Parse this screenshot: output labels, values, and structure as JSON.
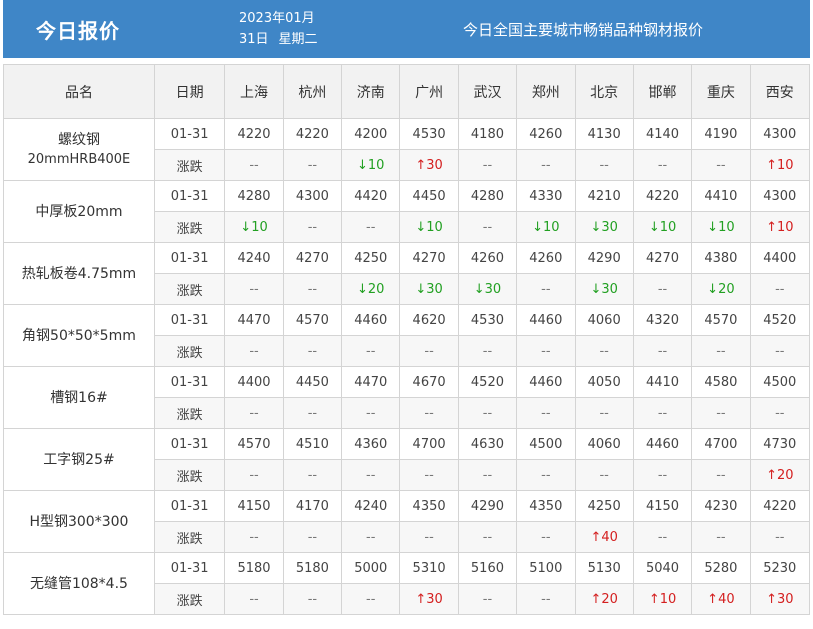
{
  "header": {
    "title": "今日报价",
    "date_line1": "2023年01月",
    "date_day": "31日",
    "date_weekday": "星期二",
    "description": "今日全国主要城市畅销品种钢材报价"
  },
  "table": {
    "col_name": "品名",
    "col_date": "日期",
    "cities": [
      "上海",
      "杭州",
      "济南",
      "广州",
      "武汉",
      "郑州",
      "北京",
      "邯郸",
      "重庆",
      "西安"
    ],
    "change_label": "涨跌",
    "products": [
      {
        "name": "螺纹钢",
        "spec": "20mmHRB400E",
        "date": "01-31",
        "prices": [
          "4220",
          "4220",
          "4200",
          "4530",
          "4180",
          "4260",
          "4130",
          "4140",
          "4190",
          "4300"
        ],
        "changes": [
          "--",
          "--",
          "↓10",
          "↑30",
          "--",
          "--",
          "--",
          "--",
          "--",
          "↑10"
        ]
      },
      {
        "name": "中厚板20mm",
        "spec": "",
        "date": "01-31",
        "prices": [
          "4280",
          "4300",
          "4420",
          "4450",
          "4280",
          "4330",
          "4210",
          "4220",
          "4410",
          "4300"
        ],
        "changes": [
          "↓10",
          "--",
          "--",
          "↓10",
          "--",
          "↓10",
          "↓30",
          "↓10",
          "↓10",
          "↑10"
        ]
      },
      {
        "name": "热轧板卷4.75mm",
        "spec": "",
        "date": "01-31",
        "prices": [
          "4240",
          "4270",
          "4250",
          "4270",
          "4260",
          "4260",
          "4290",
          "4270",
          "4380",
          "4400"
        ],
        "changes": [
          "--",
          "--",
          "↓20",
          "↓30",
          "↓30",
          "--",
          "↓30",
          "--",
          "↓20",
          "--"
        ]
      },
      {
        "name": "角钢50*50*5mm",
        "spec": "",
        "date": "01-31",
        "prices": [
          "4470",
          "4570",
          "4460",
          "4620",
          "4530",
          "4460",
          "4060",
          "4320",
          "4570",
          "4520"
        ],
        "changes": [
          "--",
          "--",
          "--",
          "--",
          "--",
          "--",
          "--",
          "--",
          "--",
          "--"
        ]
      },
      {
        "name": "槽钢16#",
        "spec": "",
        "date": "01-31",
        "prices": [
          "4400",
          "4450",
          "4470",
          "4670",
          "4520",
          "4460",
          "4050",
          "4410",
          "4580",
          "4500"
        ],
        "changes": [
          "--",
          "--",
          "--",
          "--",
          "--",
          "--",
          "--",
          "--",
          "--",
          "--"
        ]
      },
      {
        "name": "工字钢25#",
        "spec": "",
        "date": "01-31",
        "prices": [
          "4570",
          "4510",
          "4360",
          "4700",
          "4630",
          "4500",
          "4060",
          "4460",
          "4700",
          "4730"
        ],
        "changes": [
          "--",
          "--",
          "--",
          "--",
          "--",
          "--",
          "--",
          "--",
          "--",
          "↑20"
        ]
      },
      {
        "name": "H型钢300*300",
        "spec": "",
        "date": "01-31",
        "prices": [
          "4150",
          "4170",
          "4240",
          "4350",
          "4290",
          "4350",
          "4250",
          "4150",
          "4230",
          "4220"
        ],
        "changes": [
          "--",
          "--",
          "--",
          "--",
          "--",
          "--",
          "↑40",
          "--",
          "--",
          "--"
        ]
      },
      {
        "name": "无缝管108*4.5",
        "spec": "",
        "date": "01-31",
        "prices": [
          "5180",
          "5180",
          "5000",
          "5310",
          "5160",
          "5100",
          "5130",
          "5040",
          "5280",
          "5230"
        ],
        "changes": [
          "--",
          "--",
          "--",
          "↑30",
          "--",
          "--",
          "↑20",
          "↑10",
          "↑40",
          "↑30"
        ]
      }
    ]
  },
  "colors": {
    "header_bg": "#3f86c7",
    "down": "#22a022",
    "up": "#d42020"
  }
}
